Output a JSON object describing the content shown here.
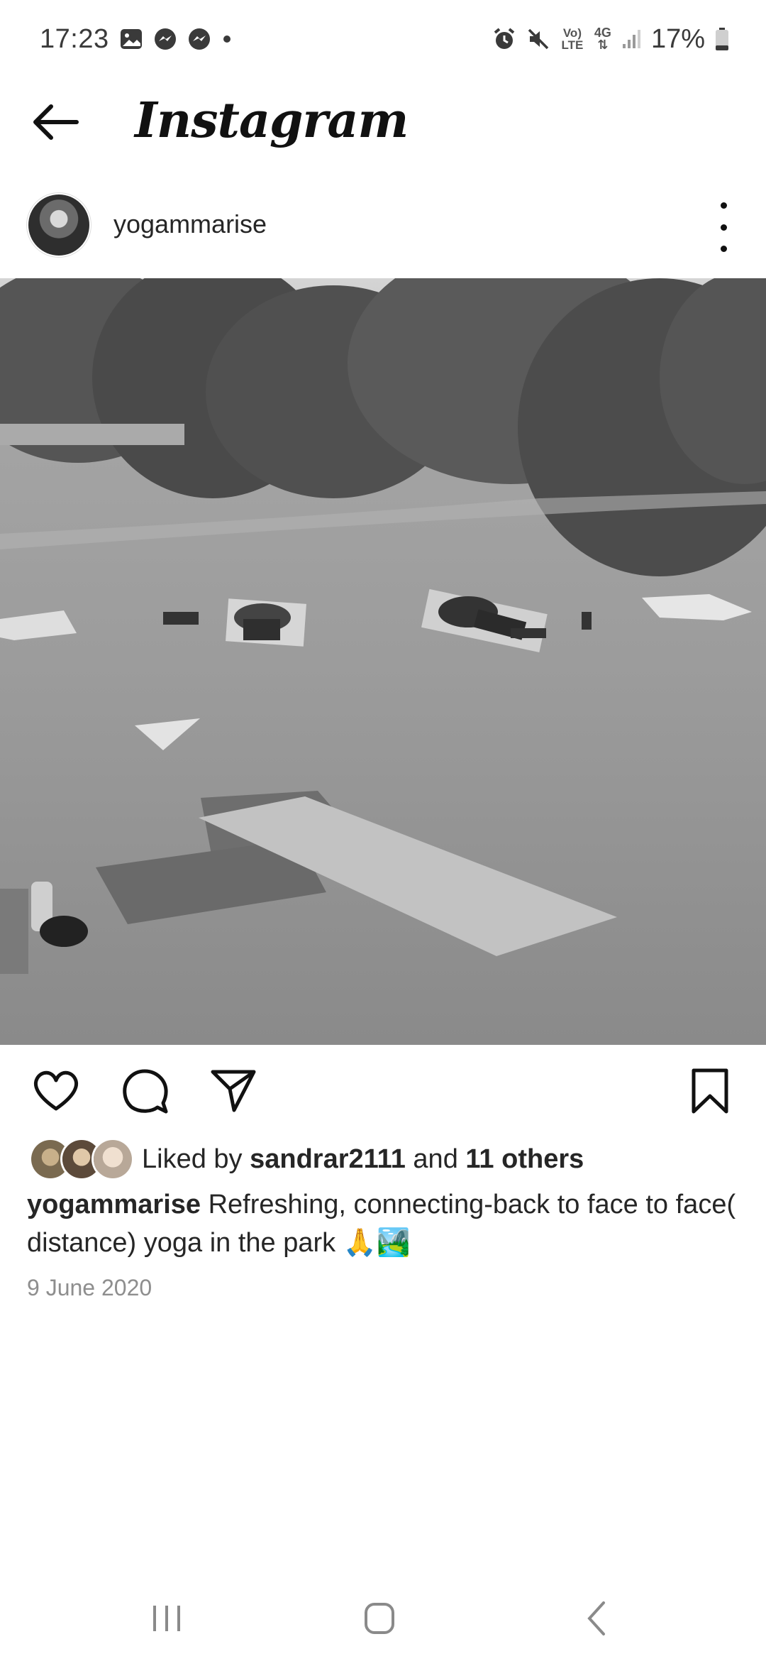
{
  "status_bar": {
    "time": "17:23",
    "left_icons": [
      "gallery-icon",
      "messenger-icon",
      "messenger-icon",
      "dot-icon"
    ],
    "right_icons": [
      "alarm-icon",
      "mute-icon",
      "volte-icon",
      "4g-icon",
      "signal-icon"
    ],
    "volte_label": "Vo) LTE",
    "network_label": "4G",
    "battery": "17%"
  },
  "app_bar": {
    "title": "Instagram"
  },
  "post": {
    "username": "yogammarise",
    "image_description_icon": "photo",
    "likes": {
      "prefix": "Liked by",
      "user": "sandrar2111",
      "middle": "and",
      "others": "11 others"
    },
    "caption": {
      "user": "yogammarise",
      "text": "Refreshing, connecting-back to face to face( distance) yoga in the park 🙏🏞️"
    },
    "date": "9 June 2020"
  },
  "colors": {
    "text": "#262626",
    "muted": "#8e8e8e",
    "background": "#ffffff"
  }
}
